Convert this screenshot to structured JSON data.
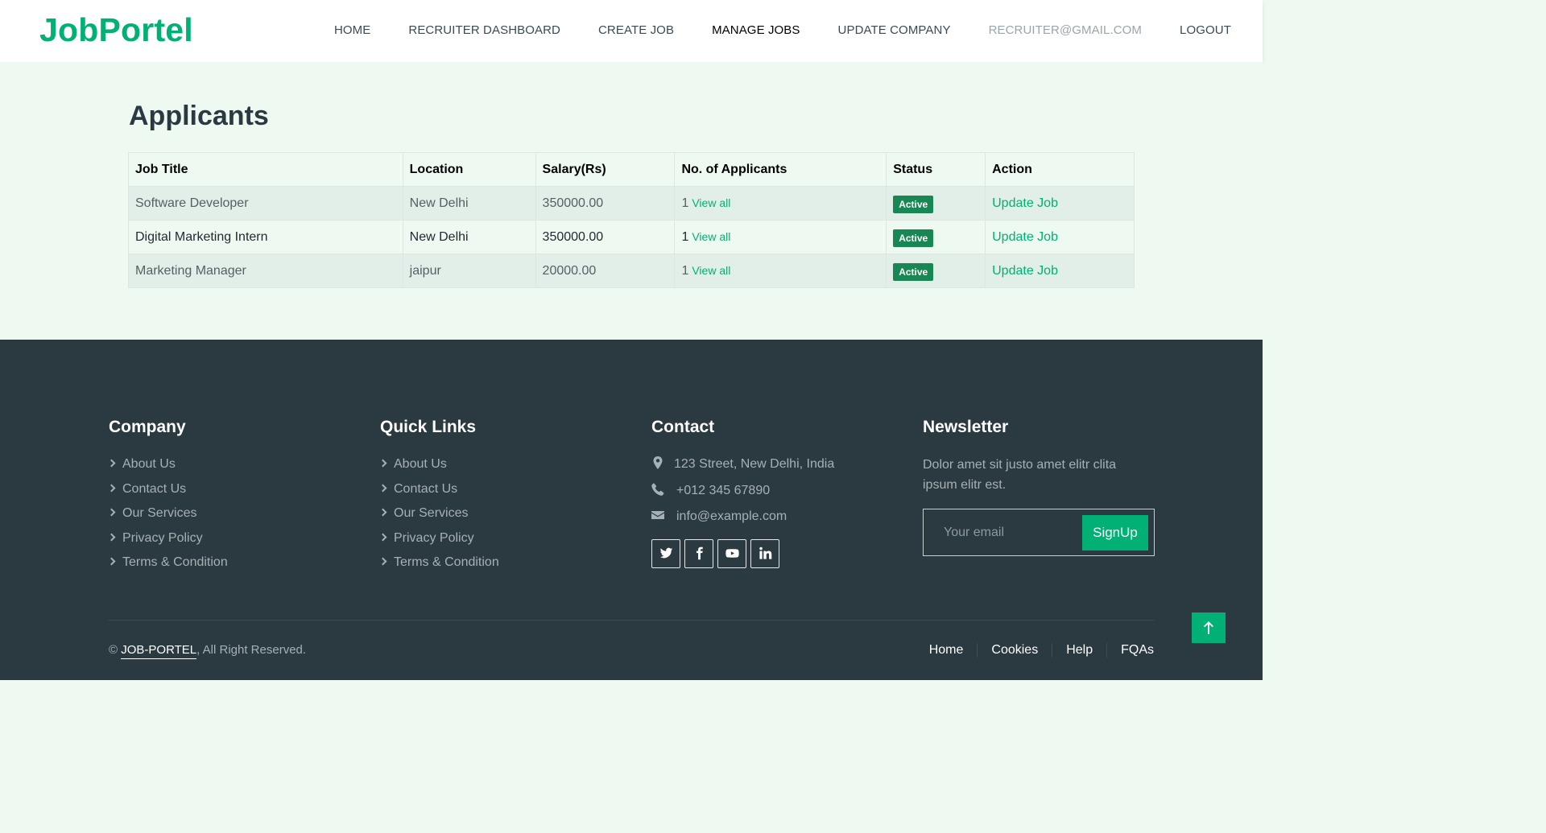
{
  "navbar": {
    "brand": "JobPortel",
    "links": [
      {
        "label": "HOME"
      },
      {
        "label": "RECRUITER DASHBOARD"
      },
      {
        "label": "CREATE JOB"
      },
      {
        "label": "MANAGE JOBS"
      },
      {
        "label": "UPDATE COMPANY"
      },
      {
        "label": "RECRUITER@GMAIL.COM"
      },
      {
        "label": "LOGOUT"
      }
    ]
  },
  "main": {
    "title": "Applicants",
    "table": {
      "headers": [
        "Job Title",
        "Location",
        "Salary(Rs)",
        "No. of Applicants",
        "Status",
        "Action"
      ],
      "rows": [
        {
          "title": "Software Developer",
          "location": "New Delhi",
          "salary": "350000.00",
          "applicants": "1",
          "view": "View all",
          "status": "Active",
          "action": "Update Job"
        },
        {
          "title": "Digital Marketing Intern",
          "location": "New Delhi",
          "salary": "350000.00",
          "applicants": "1",
          "view": "View all",
          "status": "Active",
          "action": "Update Job"
        },
        {
          "title": "Marketing Manager",
          "location": "jaipur",
          "salary": "20000.00",
          "applicants": "1",
          "view": "View all",
          "status": "Active",
          "action": "Update Job"
        }
      ]
    }
  },
  "footer": {
    "company": {
      "heading": "Company",
      "links": [
        "About Us",
        "Contact Us",
        "Our Services",
        "Privacy Policy",
        "Terms & Condition"
      ]
    },
    "quick_links": {
      "heading": "Quick Links",
      "links": [
        "About Us",
        "Contact Us",
        "Our Services",
        "Privacy Policy",
        "Terms & Condition"
      ]
    },
    "contact": {
      "heading": "Contact",
      "address": "123 Street, New Delhi, India",
      "phone": "+012 345 67890",
      "email": "info@example.com",
      "socials": [
        "twitter-icon",
        "facebook-icon",
        "youtube-icon",
        "linkedin-icon"
      ]
    },
    "newsletter": {
      "heading": "Newsletter",
      "text": "Dolor amet sit justo amet elitr clita ipsum elitr est.",
      "placeholder": "Your email",
      "button": "SignUp"
    },
    "copyright_prefix": "©",
    "copyright_brand": "JOB-PORTEL",
    "copyright_suffix": ", All Right Reserved.",
    "menu": [
      "Home",
      "Cookies",
      "Help",
      "FQAs"
    ]
  },
  "colors": {
    "accent": "#00b074",
    "footer_bg": "#2b3940",
    "page_bg": "#eef9f2",
    "badge": "#198754"
  }
}
